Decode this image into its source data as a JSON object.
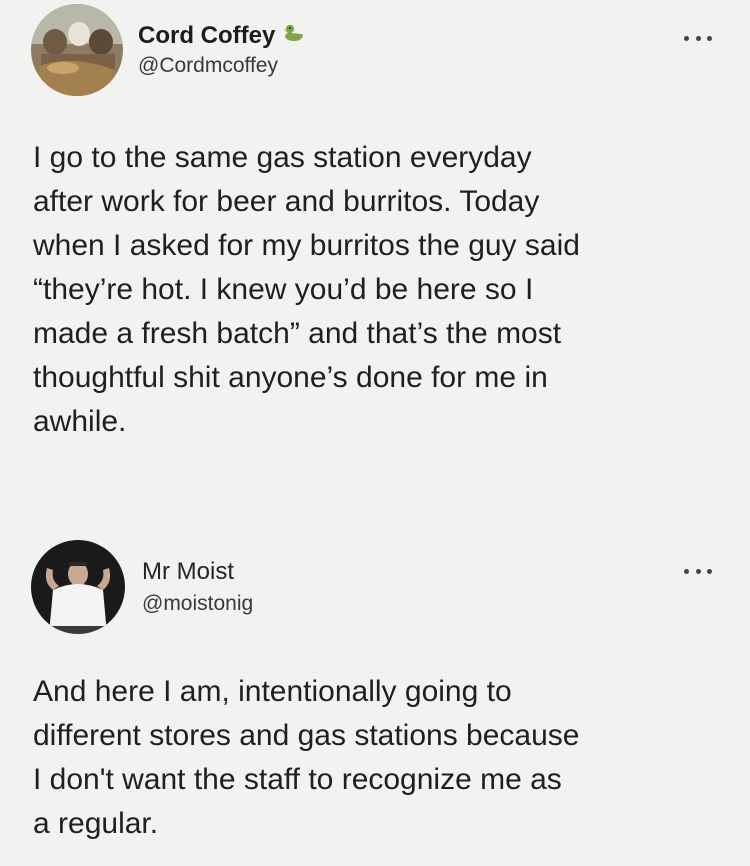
{
  "tweets": [
    {
      "display_name": "Cord Coffey",
      "handle": "@Cordmcoffey",
      "badge_icon": "duck-icon",
      "more_icon": "more-options-icon",
      "body_lines": [
        "I go to the same gas station everyday",
        "after work for beer and burritos. Today",
        "when I asked for my burritos the guy said",
        "“they’re hot. I knew you’d be here so I",
        "made a fresh batch” and that’s the most",
        "thoughtful shit anyone’s done for me in",
        "awhile."
      ]
    },
    {
      "display_name": "Mr Moist",
      "handle": "@moistonig",
      "more_icon": "more-options-icon",
      "body_lines": [
        "And here I am, intentionally going to",
        "different stores and gas stations because",
        "I don't want the staff to recognize me as",
        "a regular."
      ]
    }
  ]
}
